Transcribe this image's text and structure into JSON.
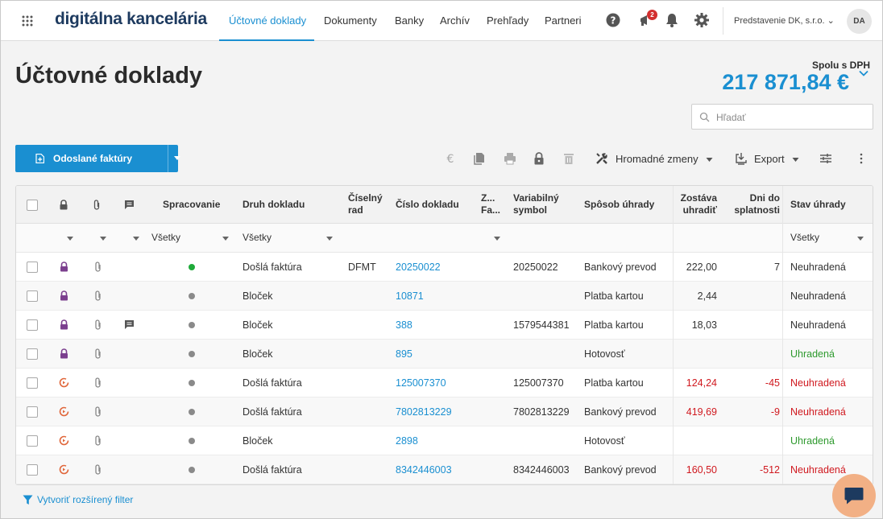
{
  "brand": "digitálna kancelária",
  "nav": {
    "tabs": [
      "Účtovné doklady",
      "Dokumenty",
      "Banky",
      "Archív",
      "Prehľady",
      "Partneri"
    ],
    "active": "Účtovné doklady",
    "notification_count": "2",
    "company": "Predstavenie DK, s.r.o.",
    "avatar": "DA"
  },
  "header": {
    "title": "Účtovné doklady",
    "total_label": "Spolu s DPH",
    "total_amount": "217 871,84 €"
  },
  "search": {
    "placeholder": "Hľadať"
  },
  "toolbar": {
    "primary_label": "Odoslané faktúry",
    "bulk_label": "Hromadné zmeny",
    "export_label": "Export"
  },
  "table": {
    "headers": {
      "processing": "Spracovanie",
      "doc_type": "Druh dokladu",
      "series_1": "Číselný",
      "series_2": "rad",
      "doc_number": "Číslo dokladu",
      "z_1": "Z...",
      "z_2": "Fa...",
      "var_symbol_1": "Variabilný",
      "var_symbol_2": "symbol",
      "payment_method": "Spôsob úhrady",
      "remaining_1": "Zostáva",
      "remaining_2": "uhradiť",
      "days_1": "Dni do",
      "days_2": "splatnosti",
      "payment_status": "Stav úhrady"
    },
    "filters": {
      "processing": "Všetky",
      "doc_type": "Všetky",
      "payment_status": "Všetky"
    },
    "rows": [
      {
        "lock": "lock",
        "comment": false,
        "status": "green",
        "type": "Došlá faktúra",
        "series": "DFMT",
        "number": "20250022",
        "vs": "20250022",
        "method": "Bankový prevod",
        "remaining": "222,00",
        "remaining_neg": false,
        "days": "7",
        "days_neg": false,
        "state": "Neuhradená",
        "state_kind": "unpaid"
      },
      {
        "lock": "lock",
        "comment": false,
        "status": "grey",
        "type": "Bloček",
        "series": "",
        "number": "10871",
        "vs": "",
        "method": "Platba kartou",
        "remaining": "2,44",
        "remaining_neg": false,
        "days": "",
        "days_neg": false,
        "state": "Neuhradená",
        "state_kind": "unpaid"
      },
      {
        "lock": "lock",
        "comment": true,
        "status": "grey",
        "type": "Bloček",
        "series": "",
        "number": "388",
        "vs": "1579544381",
        "method": "Platba kartou",
        "remaining": "18,03",
        "remaining_neg": false,
        "days": "",
        "days_neg": false,
        "state": "Neuhradená",
        "state_kind": "unpaid"
      },
      {
        "lock": "lock",
        "comment": false,
        "status": "grey",
        "type": "Bloček",
        "series": "",
        "number": "895",
        "vs": "",
        "method": "Hotovosť",
        "remaining": "",
        "remaining_neg": false,
        "days": "",
        "days_neg": false,
        "state": "Uhradená",
        "state_kind": "paid"
      },
      {
        "lock": "recycle",
        "comment": false,
        "status": "grey",
        "type": "Došlá faktúra",
        "series": "",
        "number": "125007370",
        "vs": "125007370",
        "method": "Platba kartou",
        "remaining": "124,24",
        "remaining_neg": true,
        "days": "-45",
        "days_neg": true,
        "state": "Neuhradená",
        "state_kind": "overdue"
      },
      {
        "lock": "recycle",
        "comment": false,
        "status": "grey",
        "type": "Došlá faktúra",
        "series": "",
        "number": "7802813229",
        "vs": "7802813229",
        "method": "Bankový prevod",
        "remaining": "419,69",
        "remaining_neg": true,
        "days": "-9",
        "days_neg": true,
        "state": "Neuhradená",
        "state_kind": "overdue"
      },
      {
        "lock": "recycle",
        "comment": false,
        "status": "grey",
        "type": "Bloček",
        "series": "",
        "number": "2898",
        "vs": "",
        "method": "Hotovosť",
        "remaining": "",
        "remaining_neg": false,
        "days": "",
        "days_neg": false,
        "state": "Uhradená",
        "state_kind": "paid"
      },
      {
        "lock": "recycle",
        "comment": false,
        "status": "grey",
        "type": "Došlá faktúra",
        "series": "",
        "number": "8342446003",
        "vs": "8342446003",
        "method": "Bankový prevod",
        "remaining": "160,50",
        "remaining_neg": true,
        "days": "-512",
        "days_neg": true,
        "state": "Neuhradená",
        "state_kind": "overdue"
      }
    ]
  },
  "advanced_filter_label": "Vytvoriť rozšírený filter",
  "colors": {
    "accent": "#1a8fd1",
    "brand_text": "#1d3a5f",
    "lock_purple": "#7b3f8e",
    "recycle_orange": "#e0663a",
    "status_green": "#1faa3a",
    "status_grey": "#8a8a8a",
    "negative": "#d0191f",
    "paid": "#2e9a2e",
    "chat_bubble": "#f2b085"
  },
  "icons": {
    "apps": "grid-icon",
    "help": "help-icon",
    "announce": "megaphone-icon",
    "bell": "bell-icon",
    "settings": "gear-icon",
    "euro": "euro-icon",
    "copy": "copy-icon",
    "print": "print-icon",
    "lock": "lock-icon",
    "delete": "trash-icon",
    "tools": "tools-icon",
    "export": "export-icon",
    "sliders": "sliders-icon",
    "more": "more-vertical-icon",
    "chat": "chat-icon"
  }
}
